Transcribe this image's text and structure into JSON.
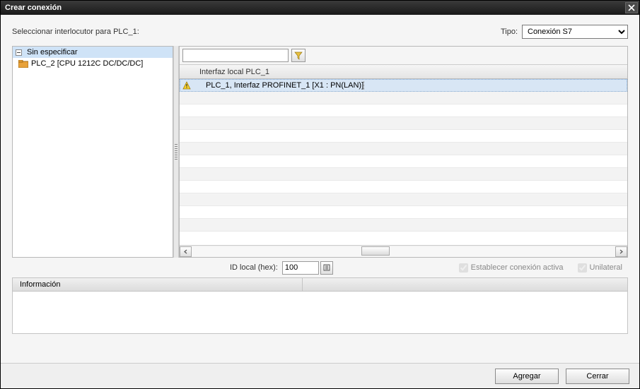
{
  "window": {
    "title": "Crear conexión"
  },
  "prompt": "Seleccionar interlocutor para PLC_1:",
  "type": {
    "label": "Tipo:",
    "selected": "Conexión S7"
  },
  "tree": {
    "root": {
      "label": "Sin especificar"
    },
    "child": {
      "label": "PLC_2 [CPU 1212C DC/DC/DC]"
    }
  },
  "grid": {
    "header": "Interfaz local PLC_1",
    "row0": "PLC_1, Interfaz PROFINET_1 [X1 : PN(LAN)]"
  },
  "filter": {
    "value": ""
  },
  "params": {
    "idlocal_label": "ID local (hex):",
    "idlocal_value": "100",
    "cb_active": "Establecer conexión activa",
    "cb_unilateral": "Unilateral"
  },
  "info": {
    "header": "Información"
  },
  "footer": {
    "add": "Agregar",
    "close": "Cerrar"
  }
}
